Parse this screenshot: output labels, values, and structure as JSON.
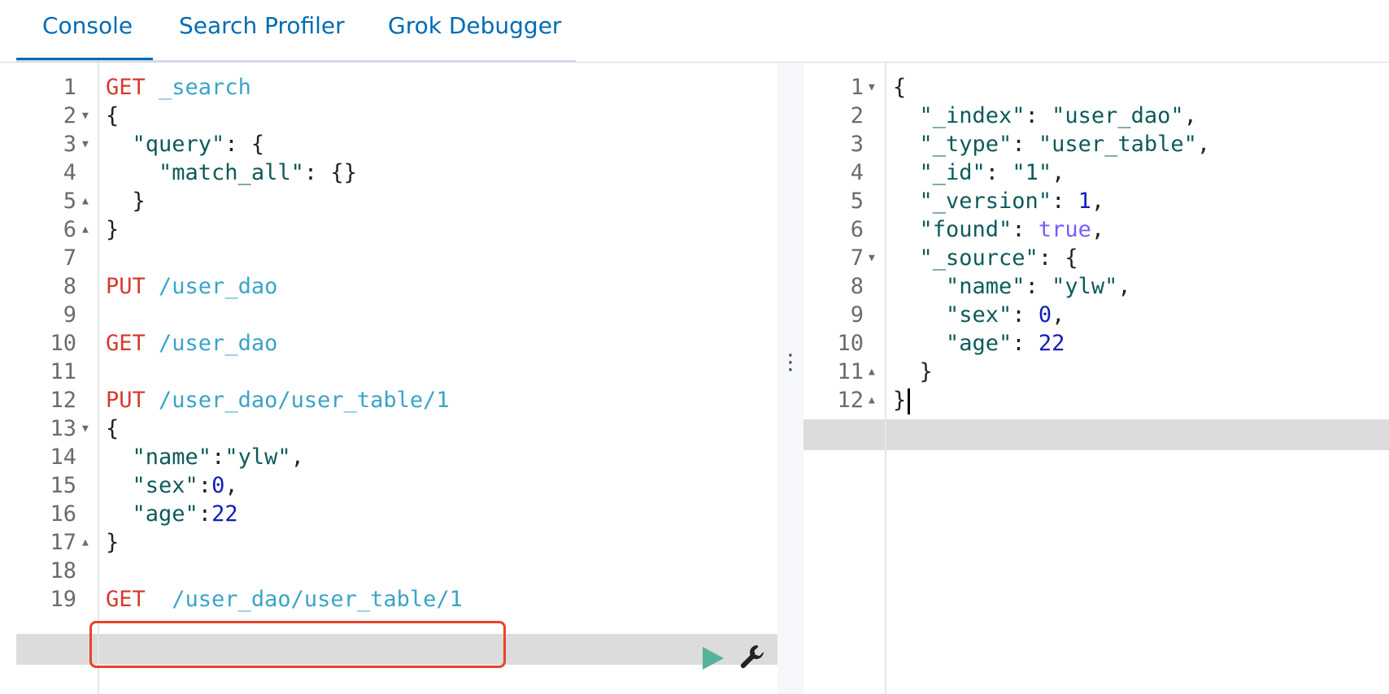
{
  "tabs": [
    {
      "label": "Console",
      "active": true
    },
    {
      "label": "Search Profiler",
      "active": false
    },
    {
      "label": "Grok Debugger",
      "active": false
    }
  ],
  "request_editor": {
    "lines": [
      {
        "num": "1",
        "tokens": [
          {
            "t": "GET",
            "c": "method"
          },
          {
            "t": " _search",
            "c": "url"
          }
        ]
      },
      {
        "num": "2",
        "fold": "down",
        "tokens": [
          {
            "t": "{",
            "c": "punc"
          }
        ]
      },
      {
        "num": "3",
        "fold": "down",
        "tokens": [
          {
            "t": "  ",
            "c": "punc"
          },
          {
            "t": "\"query\"",
            "c": "key"
          },
          {
            "t": ": {",
            "c": "punc"
          }
        ]
      },
      {
        "num": "4",
        "tokens": [
          {
            "t": "    ",
            "c": "punc"
          },
          {
            "t": "\"match_all\"",
            "c": "key"
          },
          {
            "t": ": {}",
            "c": "punc"
          }
        ]
      },
      {
        "num": "5",
        "fold": "up",
        "tokens": [
          {
            "t": "  }",
            "c": "punc"
          }
        ]
      },
      {
        "num": "6",
        "fold": "up",
        "tokens": [
          {
            "t": "}",
            "c": "punc"
          }
        ]
      },
      {
        "num": "7",
        "tokens": []
      },
      {
        "num": "8",
        "tokens": [
          {
            "t": "PUT",
            "c": "method"
          },
          {
            "t": " /user_dao",
            "c": "url"
          }
        ]
      },
      {
        "num": "9",
        "tokens": []
      },
      {
        "num": "10",
        "tokens": [
          {
            "t": "GET",
            "c": "method"
          },
          {
            "t": " /user_dao",
            "c": "url"
          }
        ]
      },
      {
        "num": "11",
        "tokens": []
      },
      {
        "num": "12",
        "tokens": [
          {
            "t": "PUT",
            "c": "method"
          },
          {
            "t": " /user_dao/user_table/1",
            "c": "url"
          }
        ]
      },
      {
        "num": "13",
        "fold": "down",
        "tokens": [
          {
            "t": "{",
            "c": "punc"
          }
        ]
      },
      {
        "num": "14",
        "tokens": [
          {
            "t": "  ",
            "c": "punc"
          },
          {
            "t": "\"name\"",
            "c": "key"
          },
          {
            "t": ":",
            "c": "punc"
          },
          {
            "t": "\"ylw\"",
            "c": "str"
          },
          {
            "t": ",",
            "c": "punc"
          }
        ]
      },
      {
        "num": "15",
        "tokens": [
          {
            "t": "  ",
            "c": "punc"
          },
          {
            "t": "\"sex\"",
            "c": "key"
          },
          {
            "t": ":",
            "c": "punc"
          },
          {
            "t": "0",
            "c": "num"
          },
          {
            "t": ",",
            "c": "punc"
          }
        ]
      },
      {
        "num": "16",
        "tokens": [
          {
            "t": "  ",
            "c": "punc"
          },
          {
            "t": "\"age\"",
            "c": "key"
          },
          {
            "t": ":",
            "c": "punc"
          },
          {
            "t": "22",
            "c": "num"
          }
        ]
      },
      {
        "num": "17",
        "fold": "up",
        "tokens": [
          {
            "t": "}",
            "c": "punc"
          }
        ]
      },
      {
        "num": "18",
        "tokens": []
      },
      {
        "num": "19",
        "active": true,
        "tokens": [
          {
            "t": "GET",
            "c": "method"
          },
          {
            "t": "  /user_dao/user_table/1",
            "c": "url"
          }
        ]
      }
    ]
  },
  "response_viewer": {
    "lines": [
      {
        "num": "1",
        "fold": "down",
        "tokens": [
          {
            "t": "{",
            "c": "punc"
          }
        ]
      },
      {
        "num": "2",
        "tokens": [
          {
            "t": "  ",
            "c": "punc"
          },
          {
            "t": "\"_index\"",
            "c": "key"
          },
          {
            "t": ": ",
            "c": "punc"
          },
          {
            "t": "\"user_dao\"",
            "c": "str"
          },
          {
            "t": ",",
            "c": "punc"
          }
        ]
      },
      {
        "num": "3",
        "tokens": [
          {
            "t": "  ",
            "c": "punc"
          },
          {
            "t": "\"_type\"",
            "c": "key"
          },
          {
            "t": ": ",
            "c": "punc"
          },
          {
            "t": "\"user_table\"",
            "c": "str"
          },
          {
            "t": ",",
            "c": "punc"
          }
        ]
      },
      {
        "num": "4",
        "tokens": [
          {
            "t": "  ",
            "c": "punc"
          },
          {
            "t": "\"_id\"",
            "c": "key"
          },
          {
            "t": ": ",
            "c": "punc"
          },
          {
            "t": "\"1\"",
            "c": "str"
          },
          {
            "t": ",",
            "c": "punc"
          }
        ]
      },
      {
        "num": "5",
        "tokens": [
          {
            "t": "  ",
            "c": "punc"
          },
          {
            "t": "\"_version\"",
            "c": "key"
          },
          {
            "t": ": ",
            "c": "punc"
          },
          {
            "t": "1",
            "c": "num"
          },
          {
            "t": ",",
            "c": "punc"
          }
        ]
      },
      {
        "num": "6",
        "tokens": [
          {
            "t": "  ",
            "c": "punc"
          },
          {
            "t": "\"found\"",
            "c": "key"
          },
          {
            "t": ": ",
            "c": "punc"
          },
          {
            "t": "true",
            "c": "bool"
          },
          {
            "t": ",",
            "c": "punc"
          }
        ]
      },
      {
        "num": "7",
        "fold": "down",
        "tokens": [
          {
            "t": "  ",
            "c": "punc"
          },
          {
            "t": "\"_source\"",
            "c": "key"
          },
          {
            "t": ": {",
            "c": "punc"
          }
        ]
      },
      {
        "num": "8",
        "tokens": [
          {
            "t": "    ",
            "c": "punc"
          },
          {
            "t": "\"name\"",
            "c": "key"
          },
          {
            "t": ": ",
            "c": "punc"
          },
          {
            "t": "\"ylw\"",
            "c": "str"
          },
          {
            "t": ",",
            "c": "punc"
          }
        ]
      },
      {
        "num": "9",
        "tokens": [
          {
            "t": "    ",
            "c": "punc"
          },
          {
            "t": "\"sex\"",
            "c": "key"
          },
          {
            "t": ": ",
            "c": "punc"
          },
          {
            "t": "0",
            "c": "num"
          },
          {
            "t": ",",
            "c": "punc"
          }
        ]
      },
      {
        "num": "10",
        "tokens": [
          {
            "t": "    ",
            "c": "punc"
          },
          {
            "t": "\"age\"",
            "c": "key"
          },
          {
            "t": ": ",
            "c": "punc"
          },
          {
            "t": "22",
            "c": "num"
          }
        ]
      },
      {
        "num": "11",
        "fold": "up",
        "tokens": [
          {
            "t": "  }",
            "c": "punc"
          }
        ]
      },
      {
        "num": "12",
        "fold": "up",
        "active": true,
        "tokens": [
          {
            "t": "}",
            "c": "punc"
          }
        ]
      }
    ]
  },
  "toolbar": {
    "play_icon": "play-icon",
    "wrench_icon": "wrench-icon"
  },
  "colors": {
    "accent": "#006bb4",
    "method": "#d73a2e",
    "url": "#3aa4c8",
    "string": "#0e5a5a",
    "number": "#1220b8",
    "boolean": "#7a5cff",
    "highlight_box": "#e8432b",
    "play": "#54b399"
  }
}
